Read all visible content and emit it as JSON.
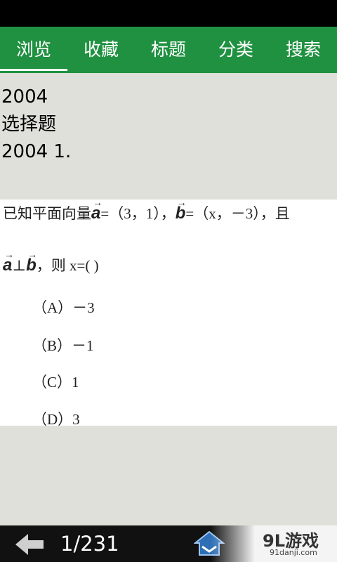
{
  "tabs": [
    {
      "label": "浏览",
      "active": true
    },
    {
      "label": "收藏",
      "active": false
    },
    {
      "label": "标题",
      "active": false
    },
    {
      "label": "分类",
      "active": false
    },
    {
      "label": "搜索",
      "active": false
    }
  ],
  "meta": {
    "year": "2004",
    "type": "选择题",
    "title": "2004 1."
  },
  "question": {
    "line1_prefix": "已知平面向量",
    "vec_a": "a",
    "eq_a": "=（3，1），",
    "vec_b": "b",
    "eq_b": "=（x，－3），且",
    "perp": "⊥",
    "line2_suffix": "，则 x=(               )",
    "options": [
      "（A）－3",
      "（B）－1",
      "（C）1",
      "（D）3"
    ]
  },
  "bottom": {
    "page": "1/231",
    "brand": "9L游戏",
    "brand_url": "91danji.com"
  },
  "colors": {
    "tab_bar": "#1f9140",
    "background": "#dfe0da",
    "status_bar": "#000000"
  }
}
